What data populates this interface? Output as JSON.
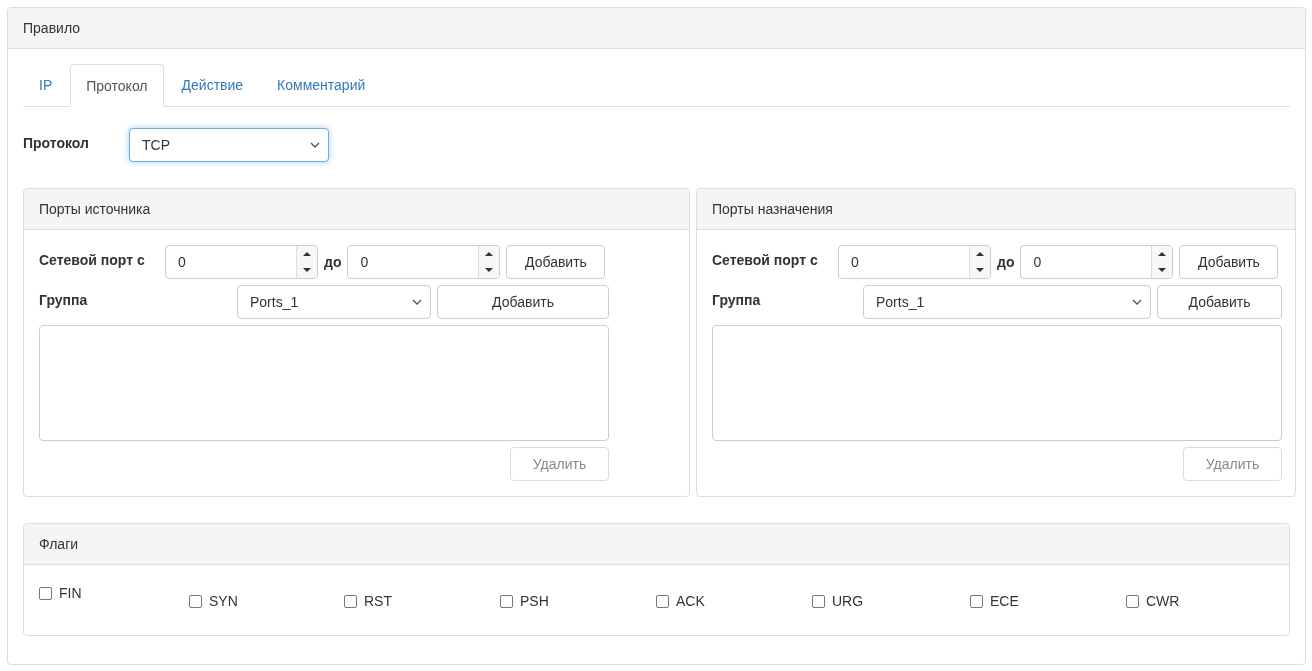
{
  "panel": {
    "title": "Правило"
  },
  "tabs": [
    {
      "label": "IP",
      "selected": false
    },
    {
      "label": "Протокол",
      "selected": true
    },
    {
      "label": "Действие",
      "selected": false
    },
    {
      "label": "Комментарий",
      "selected": false
    }
  ],
  "protocol": {
    "label": "Протокол",
    "value": "TCP"
  },
  "port_panels": [
    {
      "title": "Порты источника",
      "port_label": "Сетевой порт с",
      "from": "0",
      "to_label": "до",
      "to": "0",
      "add_button": "Добавить",
      "group_label": "Группа",
      "group": "Ports_1",
      "group_add_button": "Добавить",
      "delete_button": {
        "label": "Удалить",
        "disabled": true
      }
    },
    {
      "title": "Порты назначения",
      "port_label": "Сетевой порт с",
      "from": "0",
      "to_label": "до",
      "to": "0",
      "add_button": "Добавить",
      "group_label": "Группа",
      "group": "Ports_1",
      "group_add_button": "Добавить",
      "delete_button": {
        "label": "Удалить",
        "disabled": true
      }
    }
  ],
  "flags": {
    "title": "Флаги",
    "items": [
      {
        "label": "FIN",
        "checked": false
      },
      {
        "label": "SYN",
        "checked": false
      },
      {
        "label": "RST",
        "checked": false
      },
      {
        "label": "PSH",
        "checked": false
      },
      {
        "label": "ACK",
        "checked": false
      },
      {
        "label": "URG",
        "checked": false
      },
      {
        "label": "ECE",
        "checked": false
      },
      {
        "label": "CWR",
        "checked": false
      }
    ]
  }
}
